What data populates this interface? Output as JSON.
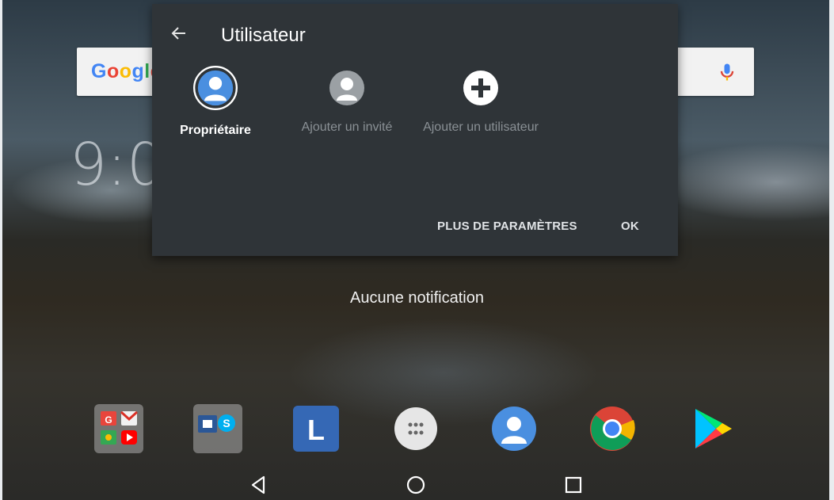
{
  "search": {
    "logo": "Google"
  },
  "clock": {
    "time": "9:0"
  },
  "panel": {
    "title": "Utilisateur",
    "users": [
      {
        "label": "Propriétaire"
      },
      {
        "label": "Ajouter un invité"
      },
      {
        "label": "Ajouter un utilisateur"
      }
    ],
    "buttons": {
      "more": "PLUS DE PARAMÈTRES",
      "ok": "OK"
    }
  },
  "notification": {
    "empty": "Aucune notification"
  },
  "dock": {
    "apps": [
      "gmail-maps-youtube-folder",
      "office-skype-folder",
      "lenovo-launcher",
      "app-drawer",
      "contacts",
      "chrome",
      "play-store"
    ]
  },
  "colors": {
    "panel_bg": "#2f3438",
    "accent_blue": "#4a8fe0"
  }
}
